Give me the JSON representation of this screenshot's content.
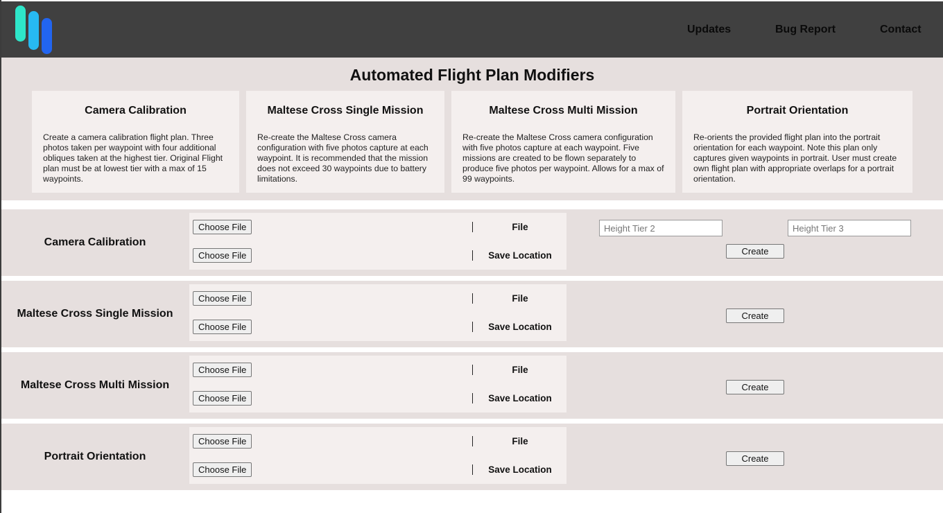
{
  "header": {
    "logo_colors": [
      "#2ee6c9",
      "#27b9f2",
      "#2265f0"
    ],
    "nav": [
      {
        "label": "Updates"
      },
      {
        "label": "Bug Report"
      },
      {
        "label": "Contact"
      }
    ]
  },
  "main": {
    "title": "Automated Flight Plan Modifiers",
    "cards": [
      {
        "title": "Camera Calibration",
        "description": "Create a camera calibration flight plan. Three photos taken per waypoint with four additional obliques taken at the highest tier. Original Flight plan must be at lowest tier with a max of 15 waypoints."
      },
      {
        "title": "Maltese Cross Single Mission",
        "description": "Re-create the Maltese Cross camera configuration with five photos capture at each waypoint. It is recommended that the mission does not exceed 30 waypoints due to battery limitations."
      },
      {
        "title": "Maltese Cross Multi Mission",
        "description": "Re-create the Maltese Cross camera configuration with five photos capture at each waypoint. Five missions are created to be flown separately to produce five photos per waypoint. Allows for a max of 99 waypoints."
      },
      {
        "title": "Portrait Orientation",
        "description": "Re-orients the provided flight plan into the portrait orientation for each waypoint. Note this plan only captures given waypoints in portrait. User must create own flight plan with appropriate overlaps for a portrait orientation."
      }
    ]
  },
  "rows": [
    {
      "label": "Camera Calibration",
      "choose_file_1": "Choose File",
      "file_label": "File",
      "choose_file_2": "Choose File",
      "save_label": "Save Location",
      "create": "Create",
      "height_tier_2_placeholder": "Height Tier 2",
      "height_tier_3_placeholder": "Height Tier 3"
    },
    {
      "label": "Maltese Cross Single Mission",
      "choose_file_1": "Choose File",
      "file_label": "File",
      "choose_file_2": "Choose File",
      "save_label": "Save Location",
      "create": "Create"
    },
    {
      "label": "Maltese Cross Multi Mission",
      "choose_file_1": "Choose File",
      "file_label": "File",
      "choose_file_2": "Choose File",
      "save_label": "Save Location",
      "create": "Create"
    },
    {
      "label": "Portrait Orientation",
      "choose_file_1": "Choose File",
      "file_label": "File",
      "choose_file_2": "Choose File",
      "save_label": "Save Location",
      "create": "Create"
    }
  ]
}
